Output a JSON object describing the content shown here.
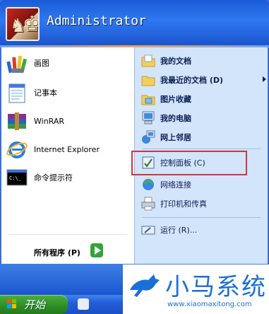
{
  "user": {
    "name": "Administrator"
  },
  "left_items": [
    {
      "label": "画图",
      "icon": "paint-icon"
    },
    {
      "label": "记事本",
      "icon": "notepad-icon"
    },
    {
      "label": "WinRAR",
      "icon": "winrar-icon"
    },
    {
      "label": "Internet Explorer",
      "icon": "ie-icon"
    },
    {
      "label": "命令提示符",
      "icon": "cmd-icon"
    }
  ],
  "all_programs": {
    "label": "所有程序 (P)"
  },
  "right_items": [
    {
      "label": "我的文档",
      "icon": "my-documents-icon",
      "bold": true
    },
    {
      "label": "我最近的文档 (D)",
      "icon": "recent-documents-icon",
      "bold": true,
      "submenu": true
    },
    {
      "label": "图片收藏",
      "icon": "my-pictures-icon",
      "bold": true
    },
    {
      "label": "我的电脑",
      "icon": "my-computer-icon",
      "bold": true
    },
    {
      "label": "网上邻居",
      "icon": "network-places-icon",
      "bold": true
    },
    {
      "label": "控制面板 (C)",
      "icon": "control-panel-icon",
      "bold": false
    },
    {
      "label": "网络连接",
      "icon": "network-connections-icon",
      "bold": false
    },
    {
      "label": "打印机和传真",
      "icon": "printers-icon",
      "bold": false
    },
    {
      "label": "运行 (R)...",
      "icon": "run-icon",
      "bold": false
    }
  ],
  "taskbar": {
    "start_label": "开始"
  },
  "watermark": {
    "title": "小马系统",
    "url": "www.xiaomaxitong.com"
  },
  "colors": {
    "highlight": "#d8323c",
    "header": "#2f78ef",
    "start": "#2e8c24"
  }
}
